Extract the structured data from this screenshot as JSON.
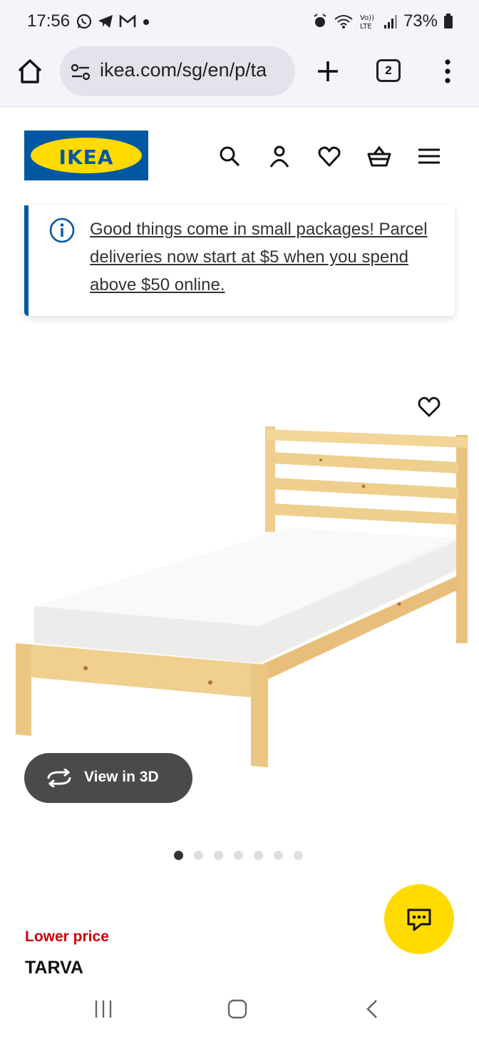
{
  "status_bar": {
    "time": "17:56",
    "battery": "73%",
    "left_icons": [
      "whatsapp-icon",
      "telegram-icon",
      "gmail-icon",
      "dot-icon"
    ],
    "right_icons": [
      "alarm-icon",
      "wifi-icon",
      "volte-icon",
      "signal-icon",
      "battery-icon"
    ]
  },
  "browser": {
    "url": "ikea.com/sg/en/p/ta",
    "tab_count": "2"
  },
  "header": {
    "logo_text": "IKEA",
    "icons": [
      "search-icon",
      "account-icon",
      "wishlist-icon",
      "cart-icon",
      "hamburger-menu-icon"
    ]
  },
  "notice": {
    "text": "Good things come in small packages! Parcel deliveries now start at $5 when you spend above $50 online."
  },
  "product": {
    "view_3d_label": "View in 3D",
    "image_count": 7,
    "active_image": 1,
    "price_badge": "Lower price",
    "name": "TARVA"
  },
  "colors": {
    "ikea_blue": "#0058a3",
    "ikea_yellow": "#ffdb00",
    "price_red": "#cc0008"
  }
}
